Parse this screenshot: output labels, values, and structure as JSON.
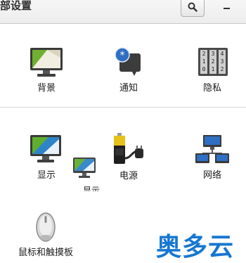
{
  "window": {
    "title": "部设置",
    "search_icon": "search-icon",
    "minimize_icon": "minimize-icon"
  },
  "sections": {
    "personal": [
      {
        "label": "背景",
        "icon": "background-icon"
      },
      {
        "label": "通知",
        "icon": "notification-icon"
      },
      {
        "label": "隐私",
        "icon": "privacy-icon"
      }
    ],
    "hardware": [
      {
        "label": "显示",
        "icon": "display-icon"
      },
      {
        "label": "电源",
        "icon": "power-icon"
      },
      {
        "label": "网络",
        "icon": "network-icon"
      },
      {
        "label": "鼠标和触摸板",
        "icon": "mouse-icon"
      }
    ]
  },
  "drag_ghost": {
    "label": "显示",
    "icon": "display-icon"
  },
  "watermark": {
    "text": "奥多云",
    "color": "#1677d0"
  }
}
